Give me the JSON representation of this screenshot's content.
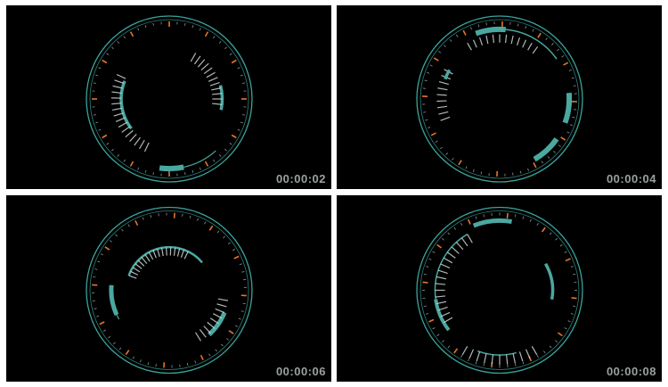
{
  "colors": {
    "background": "#000000",
    "divider": "#ffffff",
    "ring": "#3aa39a",
    "arc": "#4aa8a0",
    "tick": "#cfd8d8",
    "accent_tick": "#e8742a",
    "timecode": "#9aa0a0"
  },
  "panels": [
    {
      "timecode": "00:00:02",
      "arcs": [
        {
          "r": 0.58,
          "start": 232,
          "end": 292,
          "w": 3.5,
          "kind": "line"
        },
        {
          "r": 0.58,
          "start": 205,
          "end": 300,
          "w": 1.2,
          "kind": "spokes",
          "len": 0.12
        },
        {
          "r": 0.64,
          "start": 75,
          "end": 102,
          "w": 3.5,
          "kind": "line"
        },
        {
          "r": 0.64,
          "start": 30,
          "end": 100,
          "w": 1.2,
          "kind": "spokes",
          "len": -0.12
        },
        {
          "r": 0.84,
          "start": 168,
          "end": 188,
          "w": 6,
          "kind": "line"
        },
        {
          "r": 0.84,
          "start": 138,
          "end": 168,
          "w": 1.2,
          "kind": "line"
        }
      ]
    },
    {
      "timecode": "00:00:04",
      "arcs": [
        {
          "r": 0.84,
          "start": 340,
          "end": 5,
          "w": 6,
          "kind": "line"
        },
        {
          "r": 0.84,
          "start": 5,
          "end": 55,
          "w": 1.5,
          "kind": "line"
        },
        {
          "r": 0.84,
          "start": 85,
          "end": 110,
          "w": 6,
          "kind": "line"
        },
        {
          "r": 0.84,
          "start": 125,
          "end": 150,
          "w": 6,
          "kind": "line"
        },
        {
          "r": 0.64,
          "start": 250,
          "end": 300,
          "w": 1.2,
          "kind": "spokes",
          "len": 0.12
        },
        {
          "r": 0.7,
          "start": 290,
          "end": 300,
          "w": 3.5,
          "kind": "line"
        },
        {
          "r": 0.78,
          "start": 330,
          "end": 40,
          "w": 1.2,
          "kind": "spokes",
          "len": -0.1
        }
      ]
    },
    {
      "timecode": "00:00:06",
      "arcs": [
        {
          "r": 0.52,
          "start": 290,
          "end": 50,
          "w": 2.5,
          "kind": "line"
        },
        {
          "r": 0.52,
          "start": 290,
          "end": 30,
          "w": 1.2,
          "kind": "spokes",
          "len": -0.1
        },
        {
          "r": 0.7,
          "start": 245,
          "end": 275,
          "w": 5,
          "kind": "line"
        },
        {
          "r": 0.7,
          "start": 240,
          "end": 260,
          "w": 1.2,
          "kind": "line"
        },
        {
          "r": 0.72,
          "start": 112,
          "end": 138,
          "w": 5,
          "kind": "line"
        },
        {
          "r": 0.72,
          "start": 100,
          "end": 150,
          "w": 1.2,
          "kind": "spokes",
          "len": -0.12
        }
      ]
    },
    {
      "timecode": "00:00:08",
      "arcs": [
        {
          "r": 0.78,
          "start": 232,
          "end": 262,
          "w": 4,
          "kind": "line"
        },
        {
          "r": 0.78,
          "start": 262,
          "end": 330,
          "w": 1.5,
          "kind": "line"
        },
        {
          "r": 0.78,
          "start": 240,
          "end": 330,
          "w": 1.2,
          "kind": "spokes",
          "len": -0.12
        },
        {
          "r": 0.84,
          "start": 338,
          "end": 10,
          "w": 5,
          "kind": "line"
        },
        {
          "r": 0.64,
          "start": 60,
          "end": 100,
          "w": 3.5,
          "kind": "line"
        },
        {
          "r": 0.78,
          "start": 165,
          "end": 200,
          "w": 1.5,
          "kind": "line"
        },
        {
          "r": 0.78,
          "start": 150,
          "end": 210,
          "w": 1.2,
          "kind": "spokes",
          "len": 0.12
        }
      ]
    }
  ]
}
